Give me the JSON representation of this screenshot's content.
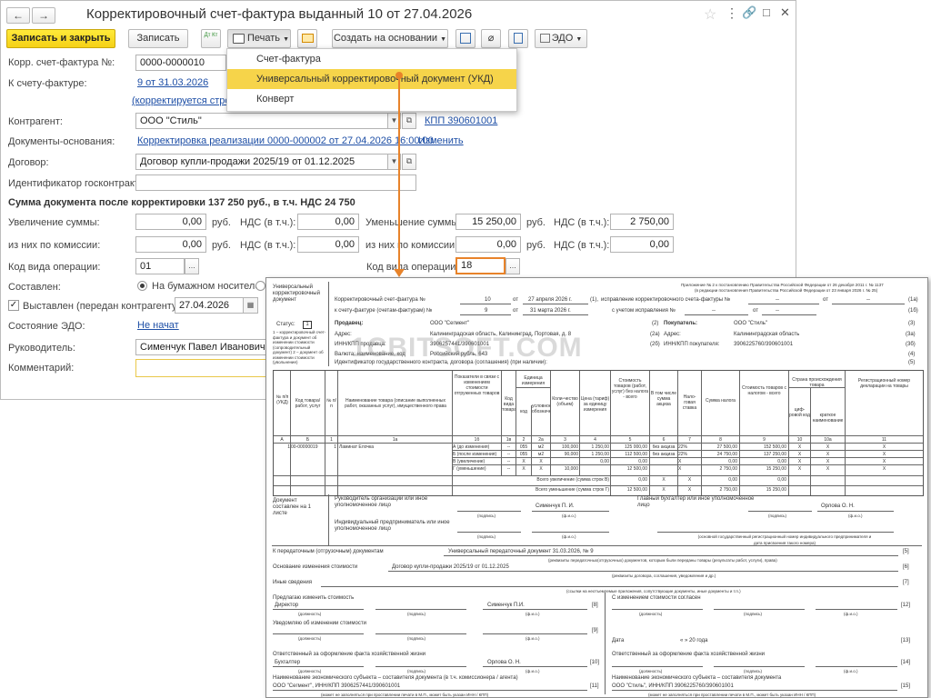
{
  "window": {
    "title": "Корректировочный счет-фактура выданный 10 от 27.04.2026",
    "star": "☆",
    "menu": "⋮",
    "link_icon": "🔗",
    "max": "□",
    "close": "✕"
  },
  "toolbar": {
    "save_close": "Записать и закрыть",
    "save": "Записать",
    "dtkt": "Дт Кт",
    "print": "Печать",
    "create_based": "Создать на основании",
    "edo": "ЭДО"
  },
  "print_menu": {
    "items": [
      "Счет-фактура",
      "Универсальный корректировочный документ (УКД)",
      "Конверт"
    ]
  },
  "form": {
    "corr_label": "Корр. счет-фактура №:",
    "corr_num": "0000-0000010",
    "to_invoice_label": "К счету-фактуре:",
    "to_invoice_link": "9 от 31.03.2026",
    "corrected_line": "(корректируется строка",
    "kontragent_label": "Контрагент:",
    "kontragent": "ООО \"Стиль\"",
    "kpp_link": "КПП 390601001",
    "docs_label": "Документы-основания:",
    "docs_link": "Корректировка реализации 0000-000002 от 27.04.2026 16:00:00",
    "change_link": "Изменить",
    "contract_label": "Договор:",
    "contract": "Договор купли-продажи 2025/19 от 01.12.2025",
    "gov_label": "Идентификатор госконтракта:",
    "sum_text": "Сумма документа после корректировки 137 250 руб., в т.ч. НДС 24 750",
    "inc_label": "Увеличение суммы:",
    "inc_val": "0,00",
    "rub": "руб.",
    "nds_label": "НДС (в т.ч.):",
    "inc_nds": "0,00",
    "dec_label": "Уменьшение суммы:",
    "dec_val": "15 250,00",
    "dec_nds": "2 750,00",
    "commission_label": "из них по комиссии:",
    "inc_comm": "0,00",
    "inc_comm_nds": "0,00",
    "dec_comm": "0,00",
    "dec_comm_nds": "0,00",
    "op_label": "Код вида операции:",
    "op_left": "01",
    "op_right": "18",
    "ellipsis": "...",
    "composed_label": "Составлен:",
    "paper": "На бумажном носителе",
    "issued_label": "Выставлен (передан контрагенту):",
    "issued_date": "27.04.2026",
    "edo_state_label": "Состояние ЭДО:",
    "edo_state": "Не начат",
    "head_label": "Руководитель:",
    "head": "Сименчук Павел Иванович",
    "comment_label": "Комментарий:"
  },
  "doc": {
    "side_title": "Универсальный корректировочный документ",
    "status_label": "Статус:",
    "status": "1",
    "status_note": "1 – корректировочный счет-фактура и документ об изменении стоимости (сопроводительный документ) 2 – документ об изменении стоимости (увольнение)",
    "appendix": "Приложение № 2 к постановлению Правительства Российской Федерации от 26 декабря 2011 г. № 1137",
    "appendix2": "(в редакции постановления Правительства Российской Федерации от 23 января 2026 г. № 25)",
    "line1_label": "Корректировочный счет-фактура №",
    "line1_num": "10",
    "line1_ot": "от",
    "line1_date": "27 апреля 2026 г.",
    "line1_code": "(1),",
    "line1_fix": "исправление корректировочного счета-фактуры №",
    "dash": "--",
    "line1_code2": "(1а)",
    "line2_label": "к счету-фактуре (счетам-фактурам) №",
    "line2_num": "9",
    "line2_date": "31 марта 2026 г.",
    "line2_fix": "с учетом исправления №",
    "line2_code": "(1б)",
    "seller_label": "Продавец:",
    "seller": "ООО \"Сегмент\"",
    "seller_code": "(2)",
    "buyer_label": "Покупатель:",
    "buyer": "ООО \"Стиль\"",
    "buyer_code": "(3)",
    "addr_label": "Адрес:",
    "seller_addr": "Калининградская область, Калининград, Портовая, д. 8",
    "seller_addr_code": "(2а)",
    "buyer_addr": "Калининградская область",
    "buyer_addr_code": "(3а)",
    "inn_label": "ИНН/КПП продавца:",
    "seller_inn": "3906257441/390601001",
    "seller_inn_code": "(2б)",
    "buyer_inn_label": "ИНН/КПП покупателя:",
    "buyer_inn": "3906225760/390601001",
    "buyer_inn_code": "(3б)",
    "currency_label": "Валюта: наименование, код",
    "currency": "Российский рубль, 643",
    "currency_code": "(4)",
    "gov_id": "Идентификатор государственного контракта, договора (соглашения) (при наличии):",
    "gov_code": "(5)",
    "table_headers": [
      "№ п/п (УКД)",
      "Код товара/ работ, услуг",
      "№ п/п",
      "Наименование товара (описание выполненных работ, оказанных услуг), имущественного права",
      "Показатели в связи с изменением стоимости отгруженных товаров",
      "Код вида товара",
      "Единица измерения",
      "Коли-чество (объем)",
      "Цена (тариф) за единицу измерения",
      "Стоимость товаров (работ, услуг) без налога - всего",
      "В том числе сумма акциза",
      "Нало-говая ставка",
      "Сумма налога",
      "Стоимость товаров с налогом - всего",
      "Страна происхождения товара",
      "Регистрационный номер декларации на товары"
    ],
    "unit_sub": [
      "код",
      "условное обозначение"
    ],
    "country_sub": [
      "циф-ровой код",
      "краткое наименование"
    ],
    "col_idx": [
      "А",
      "Б",
      "1",
      "1а",
      "1б",
      "1в",
      "2",
      "2а",
      "3",
      "4",
      "5",
      "6",
      "7",
      "8",
      "9",
      "10",
      "10а",
      "11"
    ],
    "item_num": "1",
    "item_code": "00-00000019",
    "item_row": "1",
    "item_name": "Ламинат Елочка",
    "rows": [
      {
        "k": "А (до изменения)",
        "code": "055",
        "unit": "м2",
        "qty": "100,000",
        "price": "1 250,00",
        "cost": "125 000,00",
        "akc": "без акциза",
        "rate": "22%",
        "tax": "27 500,00",
        "total": "152 500,00"
      },
      {
        "k": "Б (после изменения)",
        "code": "055",
        "unit": "м2",
        "qty": "90,000",
        "price": "1 250,00",
        "cost": "112 500,00",
        "akc": "без акциза",
        "rate": "22%",
        "tax": "24 750,00",
        "total": "137 250,00"
      },
      {
        "k": "В (увеличение)",
        "code": "X",
        "unit": "X",
        "qty": "",
        "price": "0,00",
        "cost": "0,00",
        "akc": "",
        "rate": "X",
        "tax": "0,00",
        "total": "0,00"
      },
      {
        "k": "Г (уменьшение)",
        "code": "X",
        "unit": "X",
        "qty": "10,000",
        "price": "",
        "cost": "12 500,00",
        "akc": "",
        "rate": "X",
        "tax": "2 750,00",
        "total": "15 250,00"
      }
    ],
    "x": "X",
    "total_inc": "Всего увеличение (сумма строк В)",
    "total_inc_cost": "0,00",
    "total_inc_tax": "0,00",
    "total_inc_total": "0,00",
    "total_dec": "Всего уменьшение (сумма строк Г)",
    "total_dec_cost": "12 500,00",
    "total_dec_tax": "2 750,00",
    "total_dec_total": "15 250,00",
    "composed_on": "Документ составлен на 1 листе",
    "head_org": "Руководитель организации или иное уполномоченное лицо",
    "head_name": "Сименчук П. И.",
    "chief_acc": "Главный бухгалтер или иное уполномоченное лицо",
    "chief_name": "Орлова О. Н.",
    "sign": "(подпись)",
    "fio": "(ф.и.о.)",
    "ip": "Индивидуальный предприниматель или иное уполномоченное лицо",
    "ip_note": "(основной государственный регистрационный номер индивидуального предпринимателя и дата присвоения такого номера)",
    "transfer_label": "К передаточным (отгрузочным) документам",
    "transfer": "Универсальный передаточный документ 31.03.2026, № 9",
    "c5": "[5]",
    "transfer_note": "(реквизиты передаточных(отгрузочных) документов, которым были переданы товары (результаты работ, услуги), права)",
    "basis_label": "Основание изменения стоимости",
    "basis": "Договор купли-продажи 2025/19 от 01.12.2025",
    "c6": "[6]",
    "basis_note": "(реквизиты договора, соглашения, уведомления и др.)",
    "other_label": "Иные сведения",
    "c7": "[7]",
    "other_note": "(ссылки на неотъемлемые приложения, сопутствующие документы, иные документы и т.п.)",
    "propose_label": "Предлагаю изменить стоимость",
    "director": "Директор",
    "simen": "Сименчук П.И.",
    "c8": "[8]",
    "agree_label": "С изменением стоимости согласен",
    "c12": "[12]",
    "position": "(должность)",
    "notify_label": "Уведомляю об изменении стоимости",
    "c9": "[9]",
    "date_label": "Дата",
    "date_val": "«      »              20      года",
    "c13": "[13]",
    "resp_label": "Ответственный за оформление факта хозяйственной жизни",
    "buh": "Бухгалтер",
    "orlova": "Орлова О. Н.",
    "c10": "[10]",
    "c14": "[14]",
    "econ_label": "Наименование экономического субъекта – составителя документа (в т.ч. комиссионера / агента)",
    "econ": "ООО \"Сегмент\", ИНН/КПП 3906257441/390601001",
    "c11": "[11]",
    "econ2_label": "Наименование экономического субъекта – составителя документа",
    "econ2": "ООО \"Стиль\", ИНН/КПП 3906225760/390601001",
    "c15": "[15]",
    "stamp_note": "(может не заполняться при проставлении печати в М.П., может быть указан ИНН / КПП)",
    "watermark": "1CBITSOFT.COM"
  }
}
